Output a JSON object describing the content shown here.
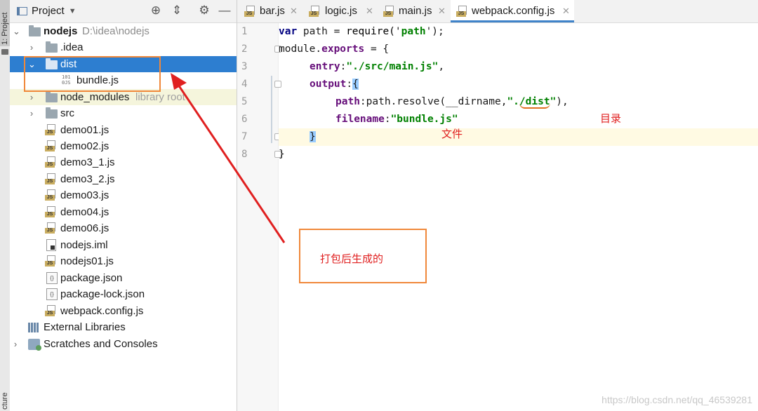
{
  "side_strip": {
    "project_tab": "1: Project",
    "structure_tab": "cture"
  },
  "panel": {
    "title": "Project"
  },
  "tree": [
    {
      "label": "nodejs",
      "hint": "D:\\idea\\nodejs"
    },
    {
      "label": ".idea"
    },
    {
      "label": "dist"
    },
    {
      "label": "bundle.js"
    },
    {
      "label": "node_modules",
      "hint": "library root"
    },
    {
      "label": "src"
    },
    {
      "label": "demo01.js"
    },
    {
      "label": "demo02.js"
    },
    {
      "label": "demo3_1.js"
    },
    {
      "label": "demo3_2.js"
    },
    {
      "label": "demo03.js"
    },
    {
      "label": "demo04.js"
    },
    {
      "label": "demo06.js"
    },
    {
      "label": "nodejs.iml"
    },
    {
      "label": "nodejs01.js"
    },
    {
      "label": "package.json"
    },
    {
      "label": "package-lock.json"
    },
    {
      "label": "webpack.config.js"
    },
    {
      "label": "External Libraries"
    },
    {
      "label": "Scratches and Consoles"
    }
  ],
  "tabs": [
    {
      "label": "bar.js"
    },
    {
      "label": "logic.js"
    },
    {
      "label": "main.js"
    },
    {
      "label": "webpack.config.js"
    }
  ],
  "line_numbers": [
    "1",
    "2",
    "3",
    "4",
    "5",
    "6",
    "7",
    "8"
  ],
  "code": {
    "l1_kw": "var",
    "l1_var": " path",
    "l1_eq": " = ",
    "l1_fn": "require(",
    "l1_q1": "'",
    "l1_str": "path",
    "l1_q2": "'",
    "l1_end": ");",
    "l2_text": "module.",
    "l2_prop": "exports",
    "l2_end": " = {",
    "l3_prop": "entry",
    "l3_colon": ":",
    "l3_str": "\"./src/main.js\"",
    "l3_end": ",",
    "l4_prop": "output",
    "l4_colon": ":",
    "l4_brace": "{",
    "l5_prop": "path",
    "l5_mid": ":path.resolve(__dirname,",
    "l5_str_a": "\".",
    "l5_str_b": "/dist",
    "l5_str_c": "\"",
    "l5_end": "),",
    "l6_prop": "filename",
    "l6_colon": ":",
    "l6_str": "\"bundle.js\"",
    "l7_brace": "}",
    "l8_brace": "}"
  },
  "annotations": {
    "directory": "目录",
    "file": "文件",
    "note": "打包后生成的"
  },
  "watermark": "https://blog.csdn.net/qq_46539281",
  "colors": {
    "selection": "#2d7ed0",
    "annotation_red": "#e02020",
    "annotation_box": "#f0883a",
    "tab_underline": "#4083c9"
  }
}
